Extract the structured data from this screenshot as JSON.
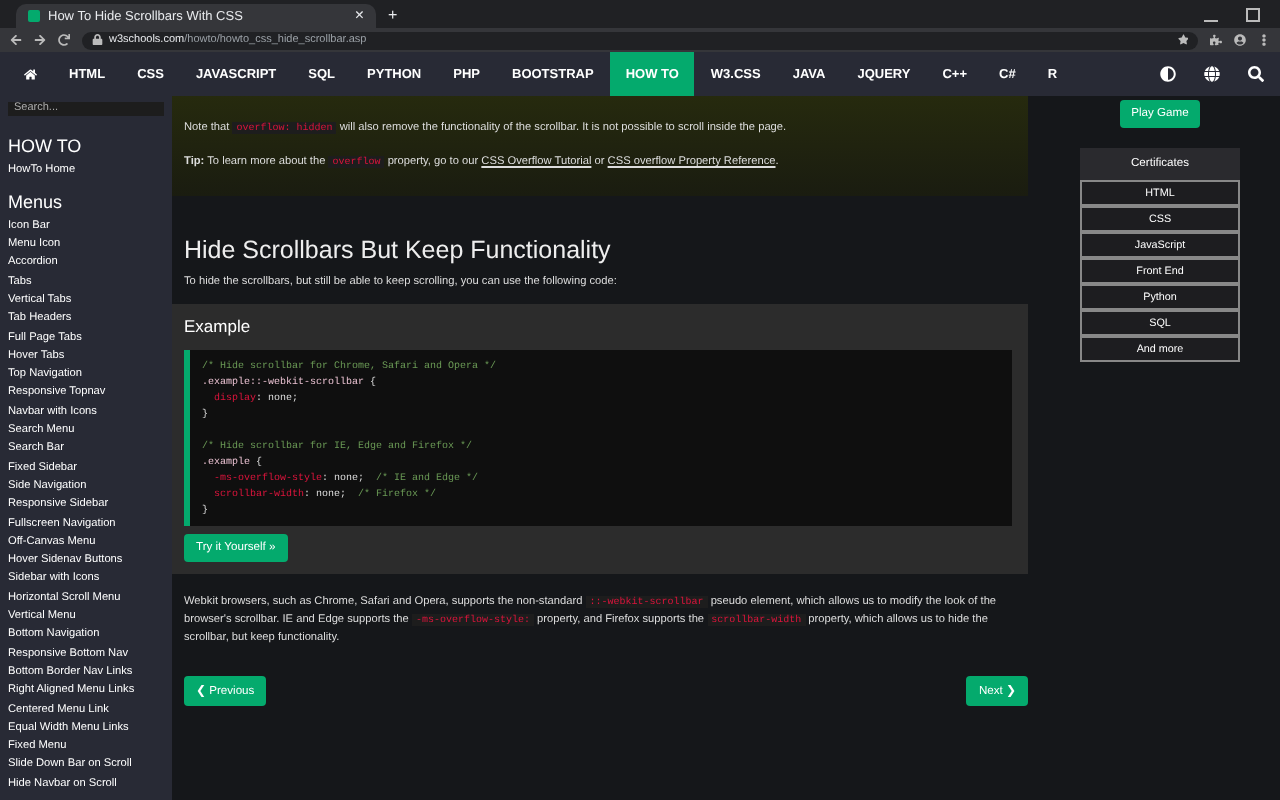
{
  "browser": {
    "tab_title": "How To Hide Scrollbars With CSS",
    "tab_close": "×",
    "new_tab": "+",
    "address_host": "w3schools.com",
    "address_path": "/howto/howto_css_hide_scrollbar.asp"
  },
  "nav": [
    {
      "label": "HTML",
      "selected": false
    },
    {
      "label": "CSS",
      "selected": false
    },
    {
      "label": "JAVASCRIPT",
      "selected": false
    },
    {
      "label": "SQL",
      "selected": false
    },
    {
      "label": "PYTHON",
      "selected": false
    },
    {
      "label": "PHP",
      "selected": false
    },
    {
      "label": "BOOTSTRAP",
      "selected": false
    },
    {
      "label": "HOW TO",
      "selected": true
    },
    {
      "label": "W3.CSS",
      "selected": false
    },
    {
      "label": "JAVA",
      "selected": false
    },
    {
      "label": "JQUERY",
      "selected": false
    },
    {
      "label": "C++",
      "selected": false
    },
    {
      "label": "C#",
      "selected": false
    },
    {
      "label": "R",
      "selected": false
    }
  ],
  "sidebar": {
    "search_placeholder": "Search...",
    "title": "HOW TO",
    "home": "HowTo Home",
    "section": "Menus",
    "items": [
      "Icon Bar",
      "Menu Icon",
      "Accordion",
      "Tabs",
      "Vertical Tabs",
      "Tab Headers",
      "Full Page Tabs",
      "Hover Tabs",
      "Top Navigation",
      "Responsive Topnav",
      "Navbar with Icons",
      "Search Menu",
      "Search Bar",
      "Fixed Sidebar",
      "Side Navigation",
      "Responsive Sidebar",
      "Fullscreen Navigation",
      "Off-Canvas Menu",
      "Hover Sidenav Buttons",
      "Sidebar with Icons",
      "Horizontal Scroll Menu",
      "Vertical Menu",
      "Bottom Navigation",
      "Responsive Bottom Nav",
      "Bottom Border Nav Links",
      "Right Aligned Menu Links",
      "Centered Menu Link",
      "Equal Width Menu Links",
      "Fixed Menu",
      "Slide Down Bar on Scroll",
      "Hide Navbar on Scroll"
    ]
  },
  "note": [
    [
      {
        "kind": "text",
        "text": "Note that "
      },
      {
        "kind": "code",
        "text": "overflow: hidden"
      },
      {
        "kind": "text",
        "text": " will also remove the functionality of the scrollbar. It is not possible to scroll inside the page."
      }
    ],
    [
      {
        "kind": "bold",
        "text": "Tip:"
      },
      {
        "kind": "text",
        "text": " To learn more about the "
      },
      {
        "kind": "code",
        "text": "overflow"
      },
      {
        "kind": "text",
        "text": " property, go to our "
      },
      {
        "kind": "link",
        "text": "CSS Overflow Tutorial"
      },
      {
        "kind": "text",
        "text": " or "
      },
      {
        "kind": "link",
        "text": "CSS overflow Property Reference"
      },
      {
        "kind": "text",
        "text": "."
      }
    ]
  ],
  "heading": "Hide Scrollbars But Keep Functionality",
  "intro": "To hide the scrollbars, but still be able to keep scrolling, you can use the following code:",
  "example": {
    "title": "Example",
    "button": "Try it Yourself »",
    "code": [
      {
        "kind": "code",
        "tokens": [
          {
            "kind": "comment",
            "text": "/* Hide scrollbar for Chrome, Safari and Opera */"
          }
        ]
      },
      {
        "kind": "code",
        "tokens": [
          {
            "kind": "selector",
            "text": ".example::-webkit-scrollbar"
          },
          {
            "kind": "plain",
            "text": " {"
          }
        ]
      },
      {
        "kind": "code",
        "tokens": [
          {
            "kind": "property",
            "text": "  display"
          },
          {
            "kind": "plain",
            "text": ": none;"
          }
        ]
      },
      {
        "kind": "code",
        "tokens": [
          {
            "kind": "plain",
            "text": "}"
          }
        ]
      },
      {
        "kind": "blank"
      },
      {
        "kind": "code",
        "tokens": [
          {
            "kind": "comment",
            "text": "/* Hide scrollbar for IE, Edge and Firefox */"
          }
        ]
      },
      {
        "kind": "code",
        "tokens": [
          {
            "kind": "selector",
            "text": ".example"
          },
          {
            "kind": "plain",
            "text": " {"
          }
        ]
      },
      {
        "kind": "code",
        "tokens": [
          {
            "kind": "property",
            "text": "  -ms-overflow-style"
          },
          {
            "kind": "plain",
            "text": ": none;  "
          },
          {
            "kind": "comment",
            "text": "/* IE and Edge */"
          }
        ]
      },
      {
        "kind": "code",
        "tokens": [
          {
            "kind": "property",
            "text": "  scrollbar-width"
          },
          {
            "kind": "plain",
            "text": ": none;  "
          },
          {
            "kind": "comment",
            "text": "/* Firefox */"
          }
        ]
      },
      {
        "kind": "code",
        "tokens": [
          {
            "kind": "plain",
            "text": "}"
          }
        ]
      }
    ]
  },
  "explanation": [
    {
      "kind": "text",
      "text": "Webkit browsers, such as Chrome, Safari and Opera, supports the non-standard "
    },
    {
      "kind": "code",
      "text": "::-webkit-scrollbar"
    },
    {
      "kind": "text",
      "text": " pseudo element, which allows us to modify the look of the browser's scrollbar. IE and Edge supports the "
    },
    {
      "kind": "code",
      "text": "-ms-overflow-style:"
    },
    {
      "kind": "text",
      "text": " property, and Firefox supports the "
    },
    {
      "kind": "code",
      "text": "scrollbar-width"
    },
    {
      "kind": "text",
      "text": " property, which allows us to hide the scrollbar, but keep functionality."
    }
  ],
  "pager": {
    "previous": "❮ Previous",
    "next": "Next ❯"
  },
  "aside": {
    "play_button": "Play Game",
    "certificates_title": "Certificates",
    "certificates": [
      "HTML",
      "CSS",
      "JavaScript",
      "Front End",
      "Python",
      "SQL",
      "And more"
    ]
  }
}
